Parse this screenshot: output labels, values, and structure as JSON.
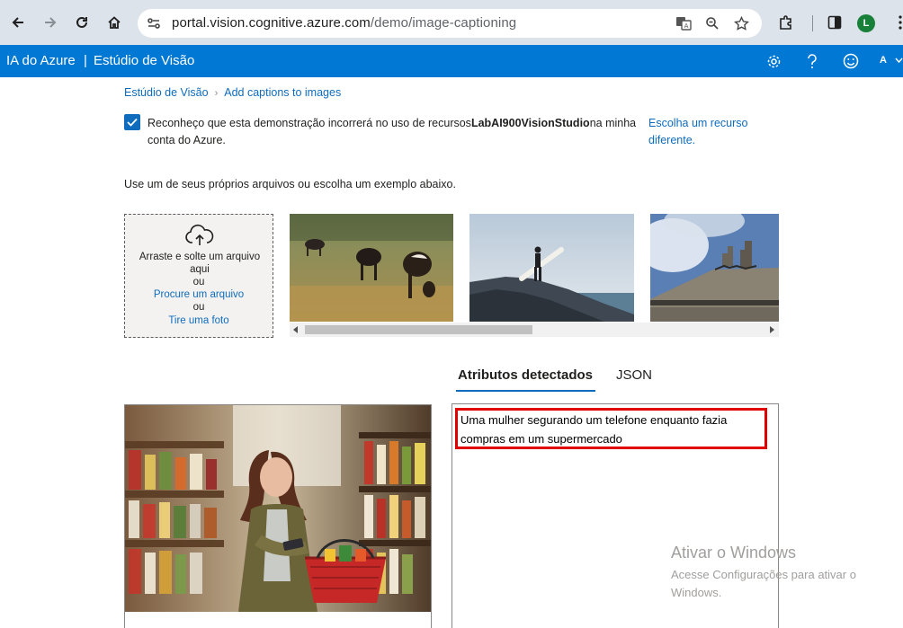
{
  "browser": {
    "url_host": "portal.vision.cognitive.azure.com",
    "url_path": "/demo/image-captioning",
    "profile_initial": "L",
    "accent": "#188038"
  },
  "azure_header": {
    "brand": "IA do Azure",
    "separator": "|",
    "studio": "Estúdio de Visão",
    "lang_initial": "A",
    "bar_color": "#0078d4"
  },
  "breadcrumb": {
    "home": "Estúdio de Visão",
    "current": "Add captions to images"
  },
  "consent": {
    "checked": true,
    "text_before": "Reconheço que esta demonstração incorrerá no uso de recursos",
    "resource": "LabAI900VisionStudio",
    "text_after": "na minha conta do Azure.",
    "choose_link": "Escolha um recurso diferente."
  },
  "instructions": "Use um de seus próprios arquivos ou escolha um exemplo abaixo.",
  "dropzone": {
    "drag_text": "Arraste e solte um arquivo aqui",
    "or_1": "ou",
    "browse_link": "Procure um arquivo",
    "or_2": "ou",
    "photo_link": "Tire uma foto"
  },
  "samples": [
    {
      "name": "cows-grazing"
    },
    {
      "name": "surfer-on-rock"
    },
    {
      "name": "building-statues"
    }
  ],
  "tabs": [
    {
      "label": "Atributos detectados",
      "active": true
    },
    {
      "label": "JSON",
      "active": false
    }
  ],
  "result": {
    "caption": "Uma mulher segurando um telefone enquanto fazia compras em um supermercado",
    "highlight_color": "#e00000"
  },
  "watermark": {
    "title": "Ativar o Windows",
    "subtitle": "Acesse Configurações para ativar o Windows."
  }
}
